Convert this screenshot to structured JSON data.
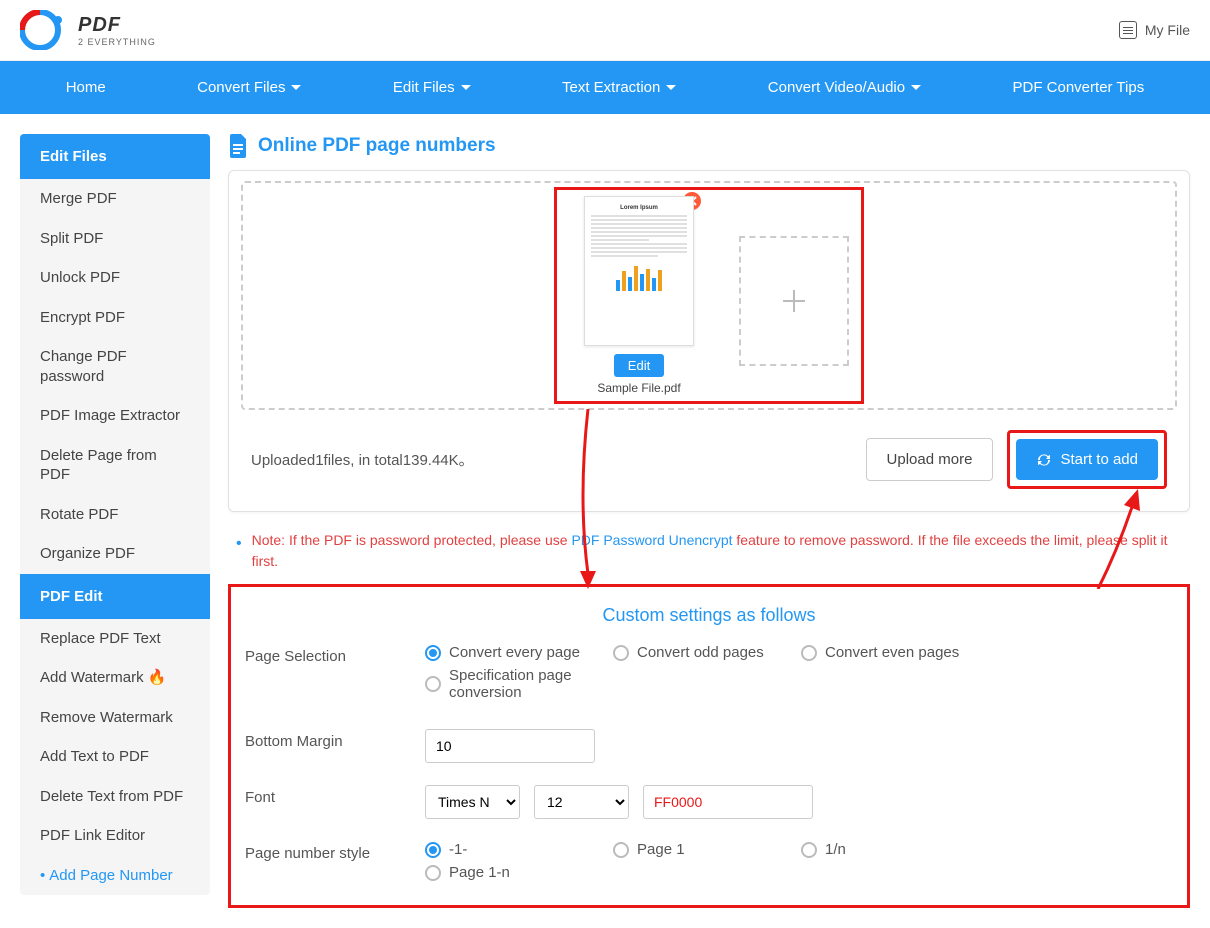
{
  "header": {
    "logo_main": "PDF",
    "logo_sub": "2 EVERYTHING",
    "myfile": "My File"
  },
  "nav": {
    "home": "Home",
    "convert_files": "Convert Files",
    "edit_files": "Edit Files",
    "text_extraction": "Text Extraction",
    "convert_video_audio": "Convert Video/Audio",
    "converter_tips": "PDF Converter Tips"
  },
  "sidebar": {
    "group1_title": "Edit Files",
    "items1": {
      "merge": "Merge PDF",
      "split": "Split PDF",
      "unlock": "Unlock PDF",
      "encrypt": "Encrypt PDF",
      "change_pw": "Change PDF password",
      "image_extract": "PDF Image Extractor",
      "delete_page": "Delete Page from PDF",
      "rotate": "Rotate PDF",
      "organize": "Organize PDF"
    },
    "group2_title": "PDF Edit",
    "items2": {
      "replace_text": "Replace PDF Text",
      "add_watermark": "Add Watermark",
      "remove_watermark": "Remove Watermark",
      "add_text": "Add Text to PDF",
      "delete_text": "Delete Text from PDF",
      "link_editor": "PDF Link Editor",
      "add_page_number": "Add Page Number"
    }
  },
  "main": {
    "title": "Online PDF page numbers",
    "thumb_title": "Lorem Ipsum",
    "edit_btn": "Edit",
    "filename": "Sample File.pdf",
    "upload_status": "Uploaded1files, in total139.44K。",
    "upload_more": "Upload more",
    "start_btn": "Start to add",
    "note_prefix": "Note: If the PDF is password protected, please use",
    "note_link": "PDF Password Unencrypt",
    "note_suffix": "feature to remove password. If the file exceeds the limit, please split it first."
  },
  "settings": {
    "title": "Custom settings as follows",
    "page_selection_label": "Page Selection",
    "opt_every": "Convert every page",
    "opt_odd": "Convert odd pages",
    "opt_even": "Convert even pages",
    "opt_spec": "Specification page conversion",
    "bottom_margin_label": "Bottom Margin",
    "bottom_margin_value": "10",
    "font_label": "Font",
    "font_name": "Times N",
    "font_size": "12",
    "font_color": "FF0000",
    "style_label": "Page number style",
    "style_1": "-1-",
    "style_2": "Page 1",
    "style_3": "1/n",
    "style_4": "Page 1-n"
  }
}
